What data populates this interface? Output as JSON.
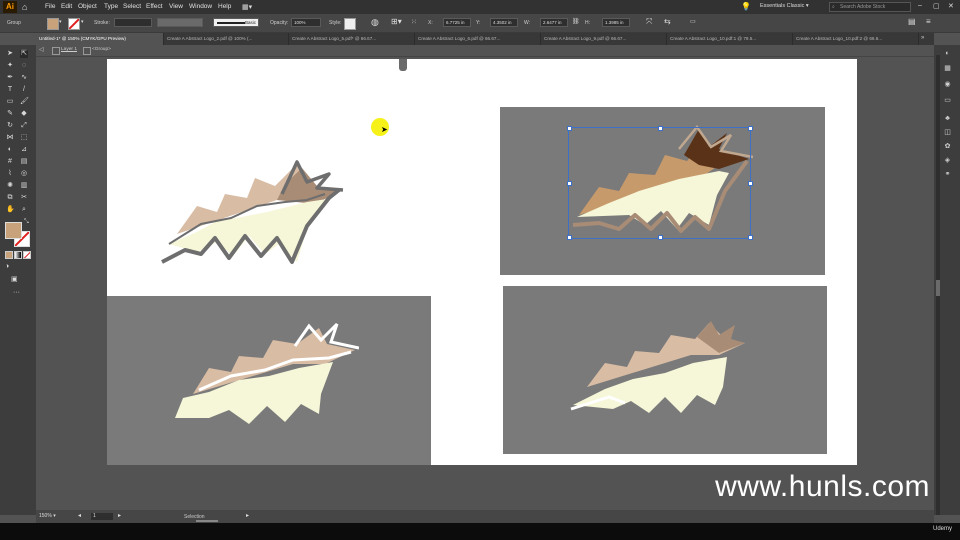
{
  "app": {
    "logo": "Ai"
  },
  "menu": [
    "File",
    "Edit",
    "Object",
    "Type",
    "Select",
    "Effect",
    "View",
    "Window",
    "Help"
  ],
  "workspace": {
    "label": "Essentials Classic",
    "search_placeholder": "Search Adobe Stock"
  },
  "controlbar": {
    "selection_type": "Group",
    "stroke_label": "Stroke:",
    "brush_label": "Basic",
    "opacity_label": "Opacity:",
    "opacity_value": "100%",
    "style_label": "Style:",
    "x_label": "X:",
    "x_value": "6.7725 in",
    "y_label": "Y:",
    "y_value": "4.3502 in",
    "w_label": "W:",
    "w_value": "2.6477 in",
    "h_label": "H:",
    "h_value": "1.3985 in"
  },
  "tabs": [
    "Untitled-1* @ 150% (CMYK/GPU Preview)",
    "Create A Abstract Logo_2.pdf @ 100% (...",
    "Create A Abstract Logo_5.pdf* @ 66.67...",
    "Create A Abstract Logo_6.pdf @ 66.67...",
    "Create A Abstract Logo_9.pdf @ 66.67...",
    "Create A Abstract Logo_10.pdf:1 @ 79.5...",
    "Create A Abstract Logo_10.pdf:2 @ 66.6..."
  ],
  "breadcrumb": {
    "layer": "Layer 1",
    "group": "<Group>"
  },
  "status": {
    "zoom": "150%",
    "artboard_num": "1",
    "tool_name": "Selection"
  },
  "watermark": "www.hunls.com",
  "footer_brand": "Udemy",
  "colors": {
    "fill": "#c8a27a",
    "leaf_cream": "#f6f6d8",
    "leaf_tan": "#d8bca4",
    "leaf_brown": "#a88c76",
    "leaf_dark": "#5a3218",
    "stroke_gray": "#6e6e6e",
    "panel_gray": "#7a7a7a"
  },
  "icons": {
    "toolbox": [
      "selection-tool-icon",
      "direct-selection-tool-icon",
      "magic-wand-icon",
      "lasso-icon",
      "pen-tool-icon",
      "curvature-icon",
      "type-tool-icon",
      "line-tool-icon",
      "rectangle-tool-icon",
      "paintbrush-icon",
      "shaper-icon",
      "pencil-icon",
      "eraser-icon",
      "rotate-icon",
      "scale-icon",
      "width-tool-icon",
      "free-transform-icon",
      "shape-builder-icon",
      "perspective-icon",
      "mesh-icon",
      "gradient-icon",
      "eyedropper-icon",
      "blend-icon",
      "symbol-sprayer-icon",
      "graph-icon",
      "artboard-tool-icon",
      "slice-icon",
      "hand-icon",
      "zoom-icon"
    ],
    "right_panel": [
      "color-icon",
      "color-guide-icon",
      "swatches-icon",
      "brushes-icon",
      "symbols-icon",
      "graphic-styles-icon",
      "appearance-icon",
      "layers-icon",
      "links-icon"
    ]
  }
}
